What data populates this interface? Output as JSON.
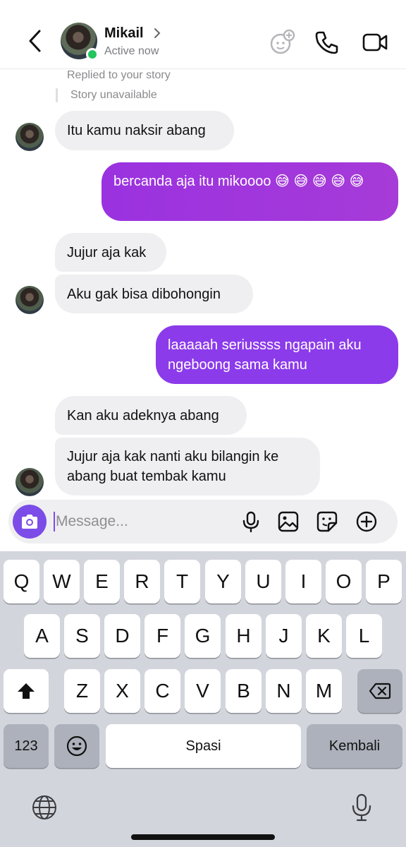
{
  "header": {
    "contact_name": "Mikail",
    "status": "Active now"
  },
  "story_reply": {
    "note": "Replied to your story",
    "story_status": "Story unavailable"
  },
  "messages": [
    {
      "from": "them",
      "text": "Itu kamu naksir abang"
    },
    {
      "from": "me",
      "text": "bercanda aja itu mikoooo 😅 😅 😅 😅 😅"
    },
    {
      "from": "them",
      "text": "Jujur aja kak"
    },
    {
      "from": "them",
      "text": "Aku gak bisa dibohongin"
    },
    {
      "from": "me",
      "text": "laaaaah seriussss ngapain aku ngeboong sama kamu"
    },
    {
      "from": "them",
      "text": "Kan aku adeknya abang"
    },
    {
      "from": "them",
      "text": "Jujur aja kak nanti aku bilangin ke abang buat tembak kamu"
    }
  ],
  "composer": {
    "placeholder": "Message...",
    "value": ""
  },
  "keyboard": {
    "row1": [
      "Q",
      "W",
      "E",
      "R",
      "T",
      "Y",
      "U",
      "I",
      "O",
      "P"
    ],
    "row2": [
      "A",
      "S",
      "D",
      "F",
      "G",
      "H",
      "J",
      "K",
      "L"
    ],
    "row3": [
      "Z",
      "X",
      "C",
      "V",
      "B",
      "N",
      "M"
    ],
    "numbers_key": "123",
    "space_key": "Spasi",
    "return_key": "Kembali"
  },
  "colors": {
    "accent": "#7c4ce8",
    "bubble_in": "#efeff1",
    "bubble_out": "#9a32e0",
    "online": "#22c55e",
    "keyboard_bg": "#d2d5dc"
  },
  "icons": [
    "back-chevron-icon",
    "chevron-right-icon",
    "effects-icon",
    "phone-icon",
    "video-call-icon",
    "camera-icon",
    "microphone-icon",
    "gallery-icon",
    "sticker-icon",
    "plus-circle-icon",
    "shift-icon",
    "backspace-icon",
    "emoji-icon",
    "globe-icon",
    "dictation-mic-icon"
  ]
}
